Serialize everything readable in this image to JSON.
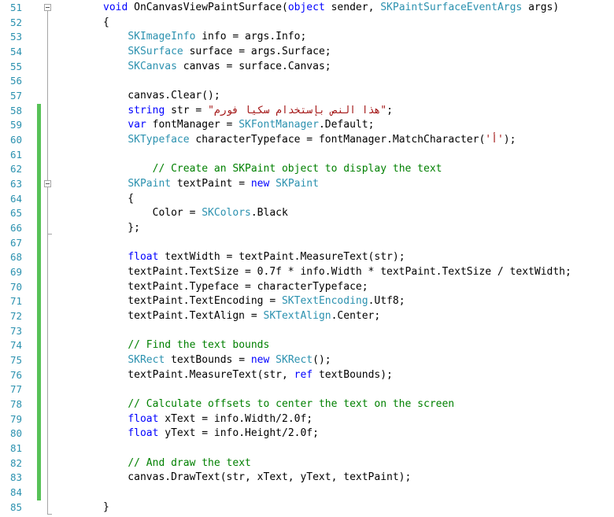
{
  "editor": {
    "colors": {
      "keyword": "#0000ff",
      "type": "#2b91af",
      "string": "#a31515",
      "comment": "#008000",
      "text": "#000000",
      "line_number": "#2b91af",
      "change_bar": "#57c157"
    },
    "lines": [
      {
        "n": "51",
        "fold": true,
        "changed": false,
        "tokens": [
          [
            "kw",
            "void"
          ],
          [
            "tx",
            " OnCanvasViewPaintSurface("
          ],
          [
            "kw",
            "object"
          ],
          [
            "tx",
            " sender, "
          ],
          [
            "ty",
            "SKPaintSurfaceEventArgs"
          ],
          [
            "tx",
            " args)"
          ]
        ]
      },
      {
        "n": "52",
        "fold": false,
        "changed": false,
        "tokens": [
          [
            "tx",
            "{"
          ]
        ]
      },
      {
        "n": "53",
        "fold": false,
        "changed": false,
        "tokens": [
          [
            "tx",
            "    "
          ],
          [
            "ty",
            "SKImageInfo"
          ],
          [
            "tx",
            " info = args.Info;"
          ]
        ]
      },
      {
        "n": "54",
        "fold": false,
        "changed": false,
        "tokens": [
          [
            "tx",
            "    "
          ],
          [
            "ty",
            "SKSurface"
          ],
          [
            "tx",
            " surface = args.Surface;"
          ]
        ]
      },
      {
        "n": "55",
        "fold": false,
        "changed": false,
        "tokens": [
          [
            "tx",
            "    "
          ],
          [
            "ty",
            "SKCanvas"
          ],
          [
            "tx",
            " canvas = surface.Canvas;"
          ]
        ]
      },
      {
        "n": "56",
        "fold": false,
        "changed": false,
        "tokens": []
      },
      {
        "n": "57",
        "fold": false,
        "changed": false,
        "tokens": [
          [
            "tx",
            "    canvas.Clear();"
          ]
        ]
      },
      {
        "n": "58",
        "fold": false,
        "changed": true,
        "tokens": [
          [
            "tx",
            "    "
          ],
          [
            "kw",
            "string"
          ],
          [
            "tx",
            " str = "
          ],
          [
            "st",
            "\"هذا النص بإستخدام سكيا فورم\""
          ],
          [
            "tx",
            ";"
          ]
        ]
      },
      {
        "n": "59",
        "fold": false,
        "changed": true,
        "tokens": [
          [
            "tx",
            "    "
          ],
          [
            "kw",
            "var"
          ],
          [
            "tx",
            " fontManager = "
          ],
          [
            "ty",
            "SKFontManager"
          ],
          [
            "tx",
            ".Default;"
          ]
        ]
      },
      {
        "n": "60",
        "fold": false,
        "changed": true,
        "tokens": [
          [
            "tx",
            "    "
          ],
          [
            "ty",
            "SKTypeface"
          ],
          [
            "tx",
            " characterTypeface = fontManager.MatchCharacter("
          ],
          [
            "st",
            "'أ'"
          ],
          [
            "tx",
            ");"
          ]
        ]
      },
      {
        "n": "61",
        "fold": false,
        "changed": true,
        "tokens": []
      },
      {
        "n": "62",
        "fold": false,
        "changed": true,
        "tokens": [
          [
            "tx",
            "        "
          ],
          [
            "cm",
            "// Create an SKPaint object to display the text"
          ]
        ]
      },
      {
        "n": "63",
        "fold": true,
        "changed": true,
        "tokens": [
          [
            "tx",
            "    "
          ],
          [
            "ty",
            "SKPaint"
          ],
          [
            "tx",
            " textPaint = "
          ],
          [
            "kw",
            "new"
          ],
          [
            "tx",
            " "
          ],
          [
            "ty",
            "SKPaint"
          ]
        ]
      },
      {
        "n": "64",
        "fold": false,
        "changed": true,
        "tokens": [
          [
            "tx",
            "    {"
          ]
        ]
      },
      {
        "n": "65",
        "fold": false,
        "changed": true,
        "tokens": [
          [
            "tx",
            "        Color = "
          ],
          [
            "ty",
            "SKColors"
          ],
          [
            "tx",
            ".Black"
          ]
        ]
      },
      {
        "n": "66",
        "fold": false,
        "changed": true,
        "tokens": [
          [
            "tx",
            "    };"
          ]
        ]
      },
      {
        "n": "67",
        "fold": false,
        "changed": true,
        "tokens": []
      },
      {
        "n": "68",
        "fold": false,
        "changed": true,
        "tokens": [
          [
            "tx",
            "    "
          ],
          [
            "kw",
            "float"
          ],
          [
            "tx",
            " textWidth = textPaint.MeasureText(str);"
          ]
        ]
      },
      {
        "n": "69",
        "fold": false,
        "changed": true,
        "tokens": [
          [
            "tx",
            "    textPaint.TextSize = 0.7f * info.Width * textPaint.TextSize / textWidth;"
          ]
        ]
      },
      {
        "n": "70",
        "fold": false,
        "changed": true,
        "tokens": [
          [
            "tx",
            "    textPaint.Typeface = characterTypeface;"
          ]
        ]
      },
      {
        "n": "71",
        "fold": false,
        "changed": true,
        "tokens": [
          [
            "tx",
            "    textPaint.TextEncoding = "
          ],
          [
            "ty",
            "SKTextEncoding"
          ],
          [
            "tx",
            ".Utf8;"
          ]
        ]
      },
      {
        "n": "72",
        "fold": false,
        "changed": true,
        "tokens": [
          [
            "tx",
            "    textPaint.TextAlign = "
          ],
          [
            "ty",
            "SKTextAlign"
          ],
          [
            "tx",
            ".Center;"
          ]
        ]
      },
      {
        "n": "73",
        "fold": false,
        "changed": true,
        "tokens": []
      },
      {
        "n": "74",
        "fold": false,
        "changed": true,
        "tokens": [
          [
            "tx",
            "    "
          ],
          [
            "cm",
            "// Find the text bounds"
          ]
        ]
      },
      {
        "n": "75",
        "fold": false,
        "changed": true,
        "tokens": [
          [
            "tx",
            "    "
          ],
          [
            "ty",
            "SKRect"
          ],
          [
            "tx",
            " textBounds = "
          ],
          [
            "kw",
            "new"
          ],
          [
            "tx",
            " "
          ],
          [
            "ty",
            "SKRect"
          ],
          [
            "tx",
            "();"
          ]
        ]
      },
      {
        "n": "76",
        "fold": false,
        "changed": true,
        "tokens": [
          [
            "tx",
            "    textPaint.MeasureText(str, "
          ],
          [
            "kw",
            "ref"
          ],
          [
            "tx",
            " textBounds);"
          ]
        ]
      },
      {
        "n": "77",
        "fold": false,
        "changed": true,
        "tokens": []
      },
      {
        "n": "78",
        "fold": false,
        "changed": true,
        "tokens": [
          [
            "tx",
            "    "
          ],
          [
            "cm",
            "// Calculate offsets to center the text on the screen"
          ]
        ]
      },
      {
        "n": "79",
        "fold": false,
        "changed": true,
        "tokens": [
          [
            "tx",
            "    "
          ],
          [
            "kw",
            "float"
          ],
          [
            "tx",
            " xText = info.Width/2.0f;"
          ]
        ]
      },
      {
        "n": "80",
        "fold": false,
        "changed": true,
        "tokens": [
          [
            "tx",
            "    "
          ],
          [
            "kw",
            "float"
          ],
          [
            "tx",
            " yText = info.Height/2.0f;"
          ]
        ]
      },
      {
        "n": "81",
        "fold": false,
        "changed": true,
        "tokens": []
      },
      {
        "n": "82",
        "fold": false,
        "changed": true,
        "tokens": [
          [
            "tx",
            "    "
          ],
          [
            "cm",
            "// And draw the text"
          ]
        ]
      },
      {
        "n": "83",
        "fold": false,
        "changed": true,
        "tokens": [
          [
            "tx",
            "    canvas.DrawText(str, xText, yText, textPaint);"
          ]
        ]
      },
      {
        "n": "84",
        "fold": false,
        "changed": true,
        "tokens": []
      },
      {
        "n": "85",
        "fold": false,
        "changed": false,
        "tokens": [
          [
            "tx",
            "}"
          ]
        ]
      }
    ]
  }
}
